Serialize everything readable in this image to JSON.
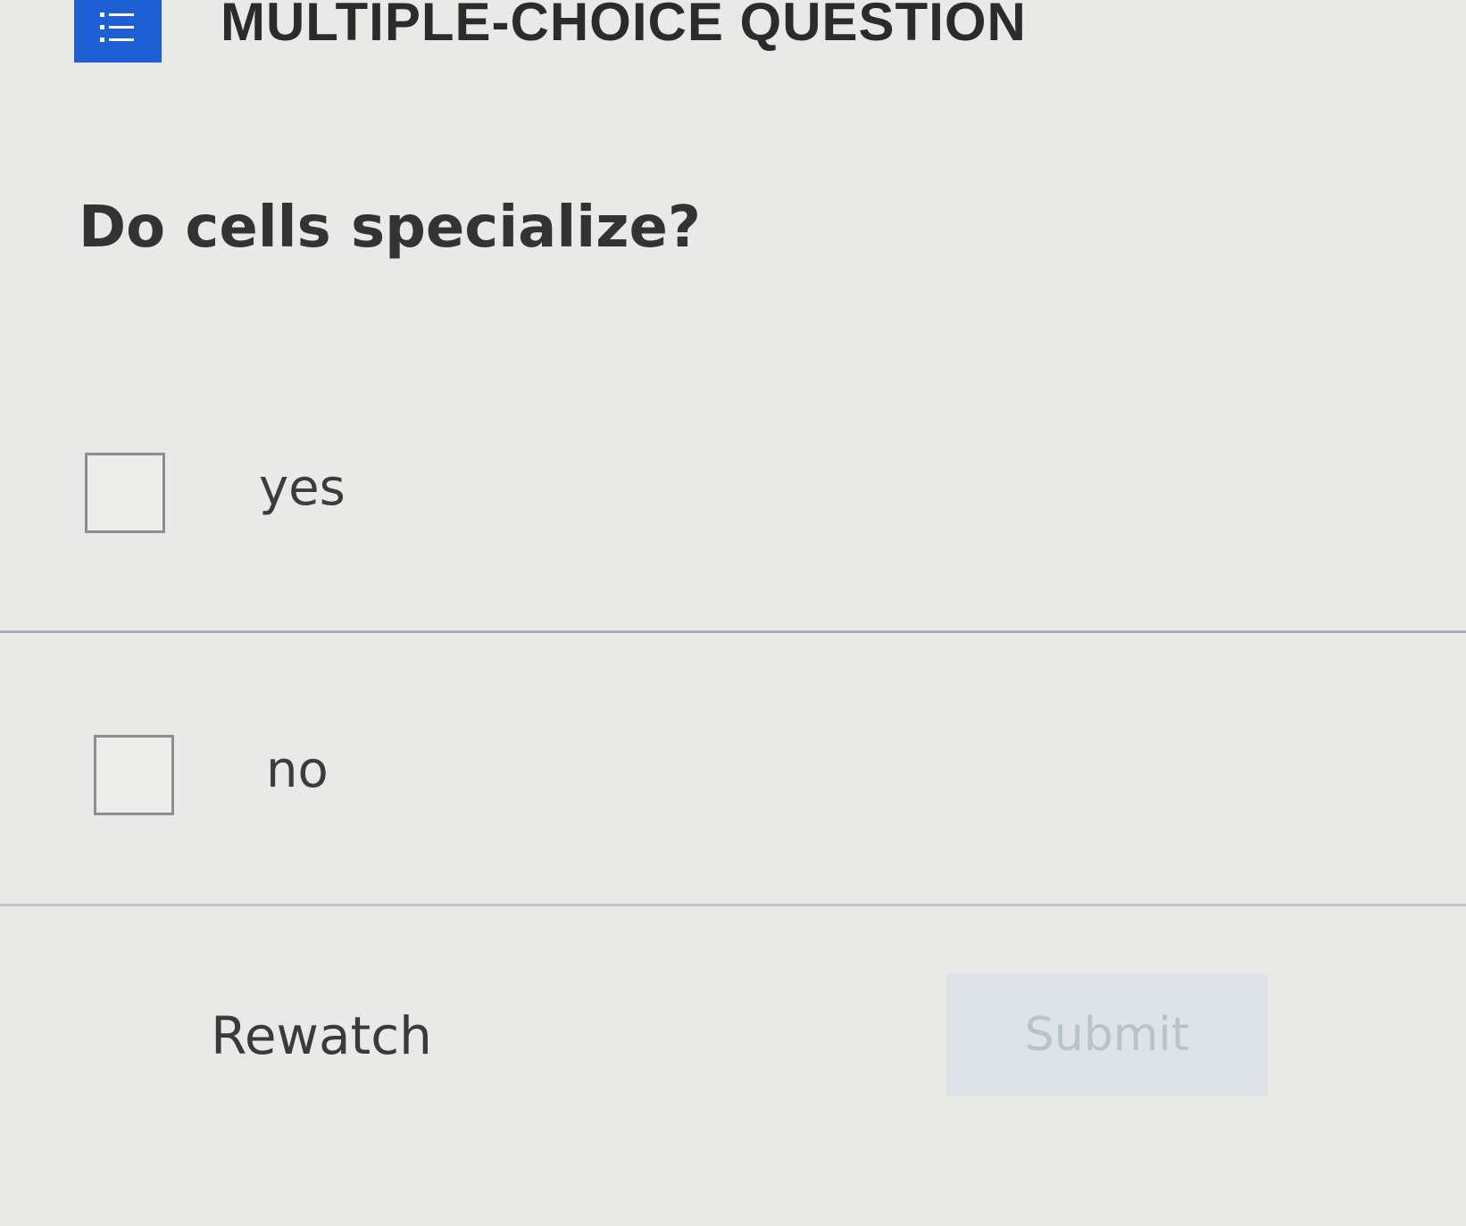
{
  "header": {
    "icon": "list-icon",
    "accent_color": "#1f5fd6",
    "title": "MULTIPLE-CHOICE QUESTION"
  },
  "question": {
    "text": "Do cells specialize?"
  },
  "options": [
    {
      "label": "yes",
      "checked": false
    },
    {
      "label": "no",
      "checked": false
    }
  ],
  "actions": {
    "rewatch_label": "Rewatch",
    "submit_label": "Submit",
    "submit_disabled": true
  }
}
